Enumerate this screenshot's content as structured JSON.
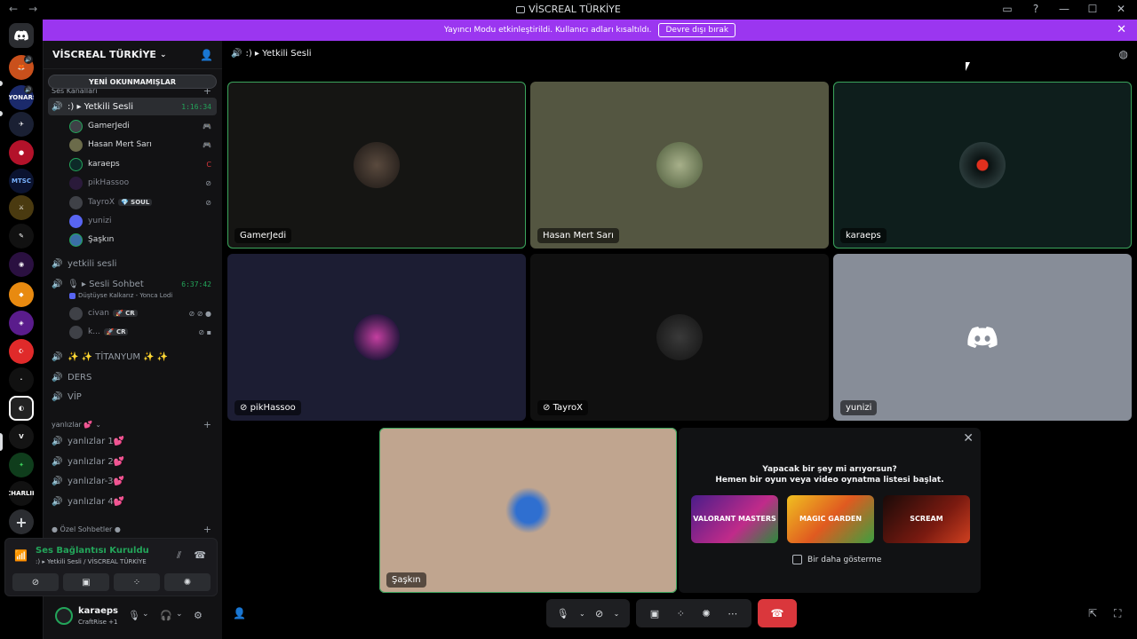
{
  "window": {
    "title": "VİSCREAL TÜRKİYE",
    "nav_back": "←",
    "nav_forward": "→"
  },
  "banner": {
    "text": "Yayıncı Modu etkinleştirildi. Kullanıcı adları kısaltıldı.",
    "button": "Devre dışı bırak",
    "close": "✕"
  },
  "server": {
    "name": "VİSCREAL TÜRKİYE",
    "unread_label": "YENİ OKUNMAMIŞLAR",
    "partial_category": "Ses Kanalları"
  },
  "channels": {
    "active": {
      "name": ":) ▸ Yetkili Sesli",
      "time": "1:16:34"
    },
    "members": [
      {
        "name": "GamerJedi",
        "icon": "🎮"
      },
      {
        "name": "Hasan Mert Sarı",
        "icon": "🎮"
      },
      {
        "name": "karaeps",
        "icon": "C"
      },
      {
        "name": "pikHassoo",
        "icon": "⊘"
      },
      {
        "name": "TayroX",
        "tag": "💎 SOUL",
        "icon": "⊘"
      },
      {
        "name": "yunizi",
        "icon": ""
      },
      {
        "name": "Şaşkın",
        "icon": ""
      }
    ],
    "yetkili": "yetkili sesli",
    "sohbet": {
      "name": "🎙 ▸ Sesli Sohbet",
      "time": "6:37:42",
      "activity": "Düştüyse Kalkarız - Yonca Lodi"
    },
    "sohbet_members": [
      {
        "name": "civan",
        "tag": "🚀 CR"
      },
      {
        "name": "k...",
        "tag": "🚀 CR"
      }
    ],
    "titanyum": "✨ ✨ TİTANYUM ✨ ✨",
    "ders": "DERS",
    "vip": "VİP",
    "cat_yanlizlar": "yanlızlar 💕",
    "yanlizlar": [
      "yanlızlar 1💕",
      "yanlızlar 2💕",
      "yanlızlar-3💕",
      "yanlızlar 4💕"
    ],
    "cat_ozel": "● Özel Sohbetler ●"
  },
  "voice": {
    "status": "Ses Bağlantısı Kuruldu",
    "location": ":) ▸ Yetkili Sesli / VİSCREAL TÜRKİYE"
  },
  "user": {
    "name": "karaeps",
    "status": "CraftRise +1"
  },
  "call": {
    "header": ":) ▸ Yetkili Sesli",
    "tiles": [
      {
        "name": "GamerJedi",
        "muted": false
      },
      {
        "name": "Hasan Mert Sarı",
        "muted": false
      },
      {
        "name": "karaeps",
        "muted": false
      },
      {
        "name": "pikHassoo",
        "muted": true
      },
      {
        "name": "TayroX",
        "muted": true
      },
      {
        "name": "yunizi",
        "muted": false
      },
      {
        "name": "Şaşkın",
        "muted": false
      }
    ],
    "muted_glyph": "⊘"
  },
  "promo": {
    "title": "Yapacak bir şey mi arıyorsun?",
    "subtitle": "Hemen bir oyun veya video oynatma listesi başlat.",
    "games": [
      "VALORANT MASTERS",
      "MAGIC GARDEN",
      "SCREAM"
    ],
    "dismiss": "Bir daha gösterme"
  },
  "rail_servers": [
    "LYONARS",
    "MTSC",
    "VİSCREAL",
    "CHARLIE"
  ],
  "colors": {
    "banner": "#9b36f0",
    "connected": "#23a55a",
    "hangup": "#da373c"
  }
}
